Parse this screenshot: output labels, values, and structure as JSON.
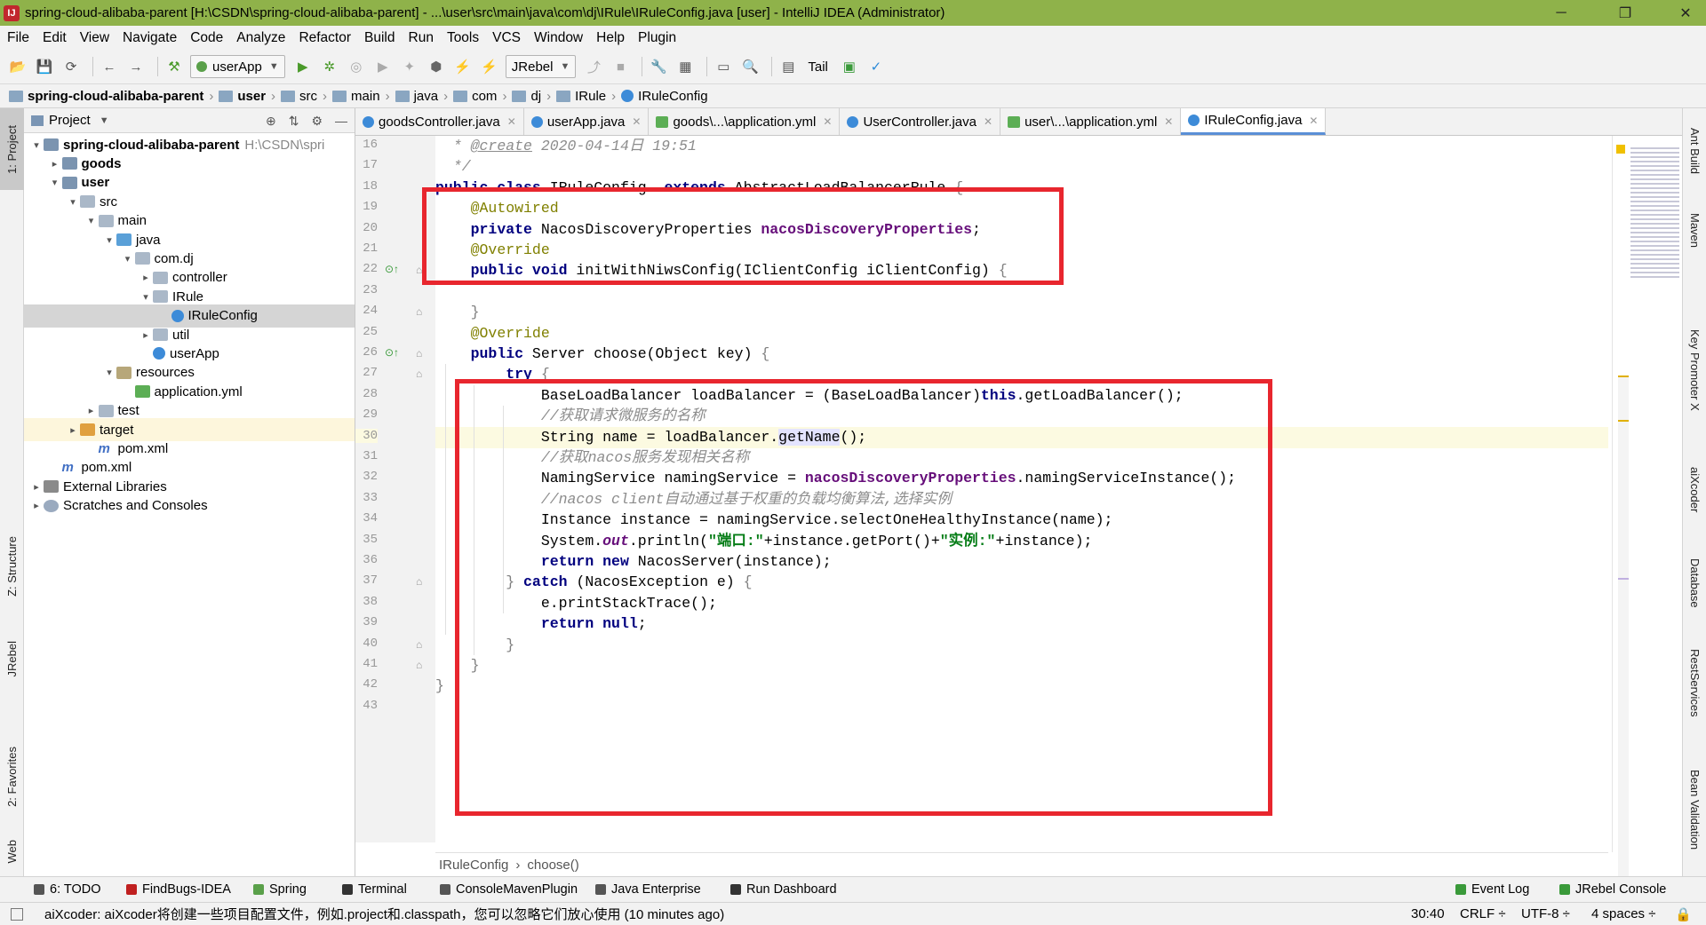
{
  "window": {
    "title": "spring-cloud-alibaba-parent [H:\\CSDN\\spring-cloud-alibaba-parent] - ...\\user\\src\\main\\java\\com\\dj\\IRule\\IRuleConfig.java [user] - IntelliJ IDEA (Administrator)",
    "minimize": "─",
    "maximize": "❐",
    "close": "✕"
  },
  "menu": [
    "File",
    "Edit",
    "View",
    "Navigate",
    "Code",
    "Analyze",
    "Refactor",
    "Build",
    "Run",
    "Tools",
    "VCS",
    "Window",
    "Help",
    "Plugin"
  ],
  "toolbar": {
    "run_config": "userApp",
    "jrebel": "JRebel",
    "tail": "Tail"
  },
  "navbar": [
    "spring-cloud-alibaba-parent",
    "user",
    "src",
    "main",
    "java",
    "com",
    "dj",
    "IRule",
    "IRuleConfig"
  ],
  "left_strip": [
    "1: Project",
    "Z: Structure",
    "JRebel",
    "2: Favorites",
    "Web"
  ],
  "right_strip": [
    "Ant Build",
    "Maven",
    "Key Promoter X",
    "aiXcoder",
    "Database",
    "RestServices",
    "Bean Validation"
  ],
  "project": {
    "header": "Project",
    "tree": [
      {
        "label": "spring-cloud-alibaba-parent",
        "extra": "H:\\CSDN\\spri",
        "bold": true,
        "arrow": "▾",
        "icon": "mod",
        "depth": 0
      },
      {
        "label": "goods",
        "bold": true,
        "arrow": "▸",
        "icon": "mod",
        "depth": 1
      },
      {
        "label": "user",
        "bold": true,
        "arrow": "▾",
        "icon": "mod",
        "depth": 1
      },
      {
        "label": "src",
        "arrow": "▾",
        "icon": "folder",
        "depth": 2
      },
      {
        "label": "main",
        "arrow": "▾",
        "icon": "folder",
        "depth": 3
      },
      {
        "label": "java",
        "arrow": "▾",
        "icon": "src",
        "depth": 4
      },
      {
        "label": "com.dj",
        "arrow": "▾",
        "icon": "folder",
        "depth": 5
      },
      {
        "label": "controller",
        "arrow": "▸",
        "icon": "folder",
        "depth": 6
      },
      {
        "label": "IRule",
        "arrow": "▾",
        "icon": "folder",
        "depth": 6
      },
      {
        "label": "IRuleConfig",
        "arrow": "",
        "icon": "cls",
        "depth": 7,
        "selected": true
      },
      {
        "label": "util",
        "arrow": "▸",
        "icon": "folder",
        "depth": 6
      },
      {
        "label": "userApp",
        "arrow": "",
        "icon": "cls",
        "depth": 6
      },
      {
        "label": "resources",
        "arrow": "▾",
        "icon": "res",
        "depth": 4
      },
      {
        "label": "application.yml",
        "arrow": "",
        "icon": "yml",
        "depth": 5
      },
      {
        "label": "test",
        "arrow": "▸",
        "icon": "folder",
        "depth": 3
      },
      {
        "label": "target",
        "arrow": "▸",
        "icon": "orange",
        "depth": 2,
        "target": true
      },
      {
        "label": "pom.xml",
        "arrow": "",
        "icon": "mvn",
        "depth": 3
      },
      {
        "label": "pom.xml",
        "arrow": "",
        "icon": "mvn",
        "depth": 1
      },
      {
        "label": "External Libraries",
        "arrow": "▸",
        "icon": "lib",
        "depth": 0
      },
      {
        "label": "Scratches and Consoles",
        "arrow": "▸",
        "icon": "scr",
        "depth": 0
      }
    ]
  },
  "tabs": [
    {
      "label": "goodsController.java",
      "kind": "class"
    },
    {
      "label": "userApp.java",
      "kind": "class"
    },
    {
      "label": "goods\\...\\application.yml",
      "kind": "yml"
    },
    {
      "label": "UserController.java",
      "kind": "class"
    },
    {
      "label": "user\\...\\application.yml",
      "kind": "yml"
    },
    {
      "label": "IRuleConfig.java",
      "kind": "class",
      "active": true
    }
  ],
  "code": [
    {
      "n": "16",
      "h": "  <span class='cm'>* <u>@create</u> 2020-04-14日 19:51</span>"
    },
    {
      "n": "17",
      "h": "  <span class='cm'>*/</span>"
    },
    {
      "n": "18",
      "h": "<span class='kw'>public class</span> IRuleConfig  <span class='kw'>extends</span> AbstractLoadBalancerRule <span class='gc'>{</span>"
    },
    {
      "n": "19",
      "h": "    <span class='an'>@Autowired</span>"
    },
    {
      "n": "20",
      "h": "    <span class='kw'>private</span> NacosDiscoveryProperties <span class='fld'>nacosDiscoveryProperties</span>;"
    },
    {
      "n": "21",
      "h": "    <span class='an'>@Override</span>"
    },
    {
      "n": "22",
      "h": "    <span class='kw'>public void</span> initWithNiwsConfig(IClientConfig iClientConfig) <span class='gc'>{</span>"
    },
    {
      "n": "23",
      "h": ""
    },
    {
      "n": "24",
      "h": "    <span class='gc'>}</span>"
    },
    {
      "n": "25",
      "h": "    <span class='an'>@Override</span>"
    },
    {
      "n": "26",
      "h": "    <span class='kw'>public</span> Server choose(Object key) <span class='gc'>{</span>"
    },
    {
      "n": "27",
      "h": "        <span class='kw'>try</span> <span class='gc'>{</span>"
    },
    {
      "n": "28",
      "h": "            BaseLoadBalancer loadBalancer = (BaseLoadBalancer)<span class='kw'>this</span>.getLoadBalancer();"
    },
    {
      "n": "29",
      "h": "            <span class='cm'>//获取请求微服务的名称</span>"
    },
    {
      "n": "30",
      "h": "            String name = loadBalancer.<span class='hl'>getName</span>();",
      "cur": true
    },
    {
      "n": "31",
      "h": "            <span class='cm'>//获取nacos服务发现相关名称</span>"
    },
    {
      "n": "32",
      "h": "            NamingService namingService = <span class='fld'>nacosDiscoveryProperties</span>.namingServiceInstance();"
    },
    {
      "n": "33",
      "h": "            <span class='cm'>//nacos client自动通过基于权重的负载均衡算法,选择实例</span>"
    },
    {
      "n": "34",
      "h": "            Instance instance = namingService.selectOneHealthyInstance(name);"
    },
    {
      "n": "35",
      "h": "            System.<span class='fld' style='font-style:italic'>out</span>.println(<span class='st'>\"端口:\"</span>+instance.getPort()+<span class='st'>\"实例:\"</span>+instance);"
    },
    {
      "n": "36",
      "h": "            <span class='kw'>return new</span> NacosServer(instance);"
    },
    {
      "n": "37",
      "h": "        <span class='gc'>}</span> <span class='kw'>catch</span> (NacosException e) <span class='gc'>{</span>"
    },
    {
      "n": "38",
      "h": "            e.printStackTrace();"
    },
    {
      "n": "39",
      "h": "            <span class='kw'>return null</span>;"
    },
    {
      "n": "40",
      "h": "        <span class='gc'>}</span>"
    },
    {
      "n": "41",
      "h": "    <span class='gc'>}</span>"
    },
    {
      "n": "42",
      "h": "<span class='gc'>}</span>"
    },
    {
      "n": "43",
      "h": ""
    }
  ],
  "editor_breadcrumb": {
    "class_name": "IRuleConfig",
    "sep": "›",
    "method": "choose()"
  },
  "bottom_tools": {
    "left": [
      "6: TODO",
      "FindBugs-IDEA",
      "Spring",
      "Terminal",
      "ConsoleMavenPlugin",
      "Java Enterprise",
      "Run Dashboard"
    ],
    "right": [
      "Event Log",
      "JRebel Console"
    ]
  },
  "status": {
    "message": "aiXcoder: aiXcoder将创建一些项目配置文件，例如.project和.classpath，您可以忽略它们放心使用 (10 minutes ago)",
    "position": "30:40",
    "line_sep": "CRLF ÷",
    "encoding": "UTF-8 ÷",
    "indent": "4 spaces ÷"
  },
  "colors": {
    "title_bar": "#8fb24a",
    "highlight_box": "#e8262e",
    "current_line": "#fcfae1",
    "keyword": "#00007f",
    "comment": "#8c8c8c"
  }
}
